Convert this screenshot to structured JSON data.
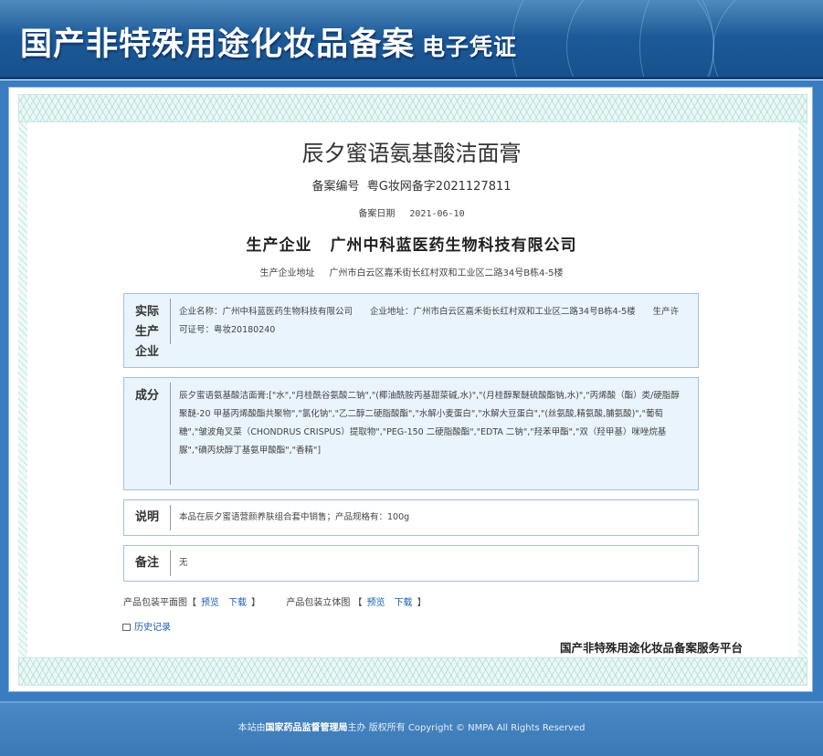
{
  "header": {
    "title": "国产非特殊用途化妆品备案",
    "subtitle": "电子凭证"
  },
  "product": {
    "name": "辰夕蜜语氨基酸洁面膏"
  },
  "registration": {
    "number_label": "备案编号",
    "number_value": "粤G妆网备字2021127811",
    "date_label": "备案日期",
    "date_value": "2021-06-10"
  },
  "producer": {
    "label": "生产企业",
    "value": "广州中科蓝医药生物科技有限公司",
    "address_label": "生产企业地址",
    "address_value": "广州市白云区嘉禾街长红村双和工业区二路34号B栋4-5楼"
  },
  "sections": {
    "actual_producer": {
      "label_chars": [
        "实际",
        "生产",
        "企业"
      ],
      "text": "企业名称：广州中科蓝医药生物科技有限公司　　企业地址：广州市白云区嘉禾街长红村双和工业区二路34号B栋4-5楼　　生产许可证号：粤妆20180240"
    },
    "ingredients": {
      "label": "成分",
      "text": "辰夕蜜语氨基酸洁面膏:[\"水\",\"月桂酰谷氨酸二钠\",\"(椰油酰胺丙基甜菜碱,水)\",\"(月桂醇聚醚硫酸酯钠,水)\",\"丙烯酸（酯）类/硬脂醇聚醚-20 甲基丙烯酸酯共聚物\",\"氯化钠\",\"乙二醇二硬脂酸酯\",\"水解小麦蛋白\",\"水解大豆蛋白\",\"(丝氨酸,精氨酸,脯氨酸)\",\"葡萄糖\",\"皱波角叉菜（CHONDRUS CRISPUS）提取物\",\"PEG-150 二硬脂酸酯\",\"EDTA 二钠\",\"羟苯甲酯\",\"双（羟甲基）咪唑烷基脲\",\"碘丙炔醇丁基氨甲酸酯\",\"香精\"]"
    },
    "description": {
      "label": "说明",
      "text": "本品在辰夕蜜语营颜养肤组合套中销售；产品规格有：100g"
    },
    "remarks": {
      "label": "备注",
      "text": "无"
    }
  },
  "links": {
    "flat_label": "产品包装平面图【",
    "flat_preview": "预览",
    "flat_download": "下载",
    "flat_close": "】",
    "solid_label": "产品包装立体图 【",
    "solid_preview": "预览",
    "solid_download": "下载",
    "solid_close": "】",
    "history": "历史记录"
  },
  "platform": "国产非特殊用途化妆品备案服务平台",
  "footer": {
    "prefix": "本站由",
    "org": "国家药品监督管理局",
    "suffix": "主办 版权所有 Copyright © NMPA All Rights Reserved"
  },
  "colors": {
    "header_blue": "#1d5a98",
    "frame_blue": "#3a7cc0",
    "link_blue": "#1a5fb4",
    "box_fill": "#e9f4fc"
  }
}
